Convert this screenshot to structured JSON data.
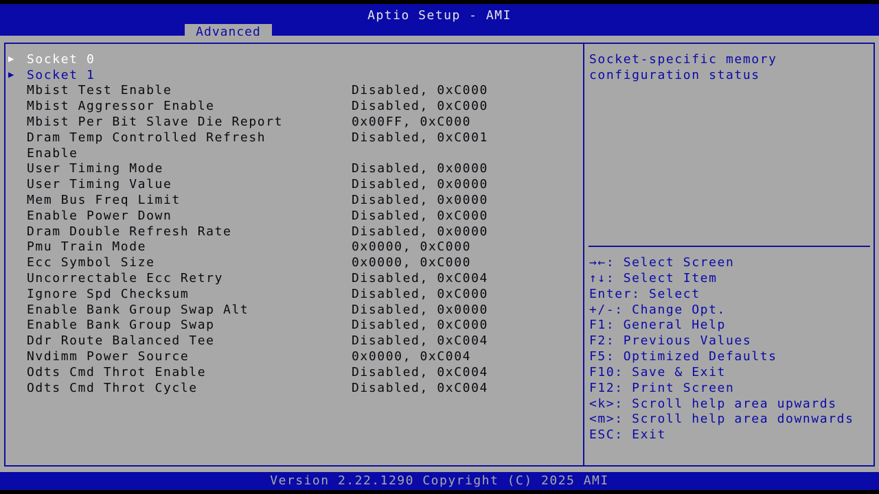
{
  "header": {
    "title": "Aptio Setup - AMI",
    "tab": "Advanced"
  },
  "menu": {
    "submenus": [
      {
        "label": "Socket 0",
        "arrow_icon": "triangle-right-icon",
        "selected": true
      },
      {
        "label": "Socket 1",
        "arrow_icon": "triangle-right-icon",
        "selected": false
      }
    ],
    "items": [
      {
        "label": "Mbist Test Enable",
        "value": "Disabled, 0xC000"
      },
      {
        "label": "Mbist Aggressor Enable",
        "value": "Disabled, 0xC000"
      },
      {
        "label": "Mbist Per Bit Slave Die Report",
        "value": "0x00FF, 0xC000"
      },
      {
        "label": "Dram Temp Controlled Refresh",
        "label2": "Enable",
        "value": "Disabled, 0xC001"
      },
      {
        "label": "User Timing Mode",
        "value": "Disabled, 0x0000"
      },
      {
        "label": "User Timing Value",
        "value": "Disabled, 0x0000"
      },
      {
        "label": "Mem Bus Freq Limit",
        "value": "Disabled, 0x0000"
      },
      {
        "label": "Enable Power Down",
        "value": "Disabled, 0xC000"
      },
      {
        "label": "Dram Double Refresh Rate",
        "value": "Disabled, 0x0000"
      },
      {
        "label": "Pmu Train Mode",
        "value": "0x0000, 0xC000"
      },
      {
        "label": "Ecc Symbol Size",
        "value": "0x0000, 0xC000"
      },
      {
        "label": "Uncorrectable Ecc Retry",
        "value": "Disabled, 0xC004"
      },
      {
        "label": "Ignore Spd Checksum",
        "value": "Disabled, 0xC000"
      },
      {
        "label": "Enable Bank Group Swap Alt",
        "value": "Disabled, 0x0000"
      },
      {
        "label": "Enable Bank Group Swap",
        "value": "Disabled, 0xC000"
      },
      {
        "label": "Ddr Route Balanced Tee",
        "value": "Disabled, 0xC004"
      },
      {
        "label": "Nvdimm Power Source",
        "value": "0x0000, 0xC004"
      },
      {
        "label": "Odts Cmd Throt Enable",
        "value": "Disabled, 0xC004"
      },
      {
        "label": "Odts Cmd Throt Cycle",
        "value": "Disabled, 0xC004"
      }
    ]
  },
  "help": {
    "lines": [
      "Socket-specific memory",
      "configuration status"
    ]
  },
  "keys": [
    "→←: Select Screen",
    "↑↓: Select Item",
    "Enter: Select",
    "+/-: Change Opt.",
    "F1: General Help",
    "F2: Previous Values",
    "F5: Optimized Defaults",
    "F10: Save & Exit",
    "F12: Print Screen",
    "<k>: Scroll help area upwards",
    "<m>: Scroll help area downwards",
    "ESC: Exit"
  ],
  "footer": {
    "version": "Version 2.22.1290 Copyright (C) 2025 AMI"
  },
  "colors": {
    "bios_blue": "#0a0aa8",
    "panel_gray": "#a8a8a8",
    "selected_text": "#ffffff"
  }
}
